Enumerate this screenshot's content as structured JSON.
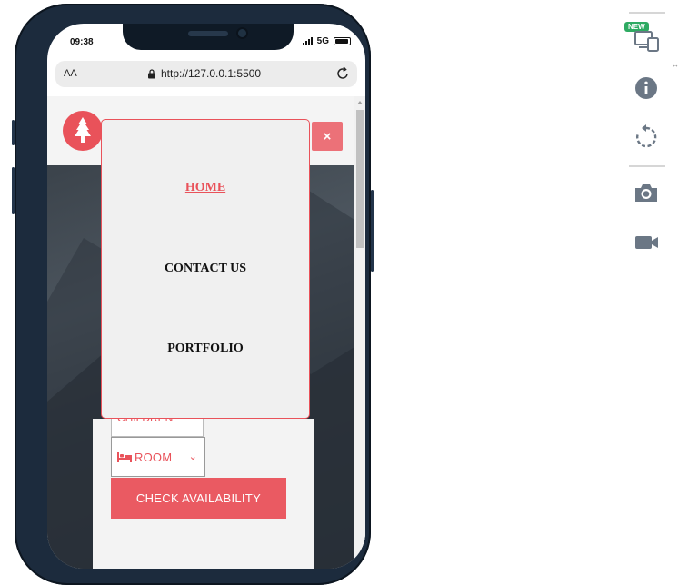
{
  "device": {
    "status": {
      "time": "09:38",
      "network": "5G"
    },
    "browser": {
      "text_size_label": "AA",
      "url": "http://127.0.0.1:5500"
    }
  },
  "site": {
    "nav_menu": {
      "items": [
        {
          "label": "HOME",
          "active": true
        },
        {
          "label": "CONTACT US",
          "active": false
        },
        {
          "label": "PORTFOLIO",
          "active": false
        }
      ]
    },
    "close_label": "×",
    "booking": {
      "children_label": "CHILDREN",
      "room_label": "ROOM",
      "check_label": "CHECK AVAILABILITY"
    },
    "colors": {
      "accent": "#e9525a"
    }
  },
  "toolbar": {
    "new_badge": "NEW",
    "icons": [
      "device-toggle-icon",
      "info-icon",
      "rotate-icon",
      "camera-icon",
      "video-icon"
    ]
  }
}
